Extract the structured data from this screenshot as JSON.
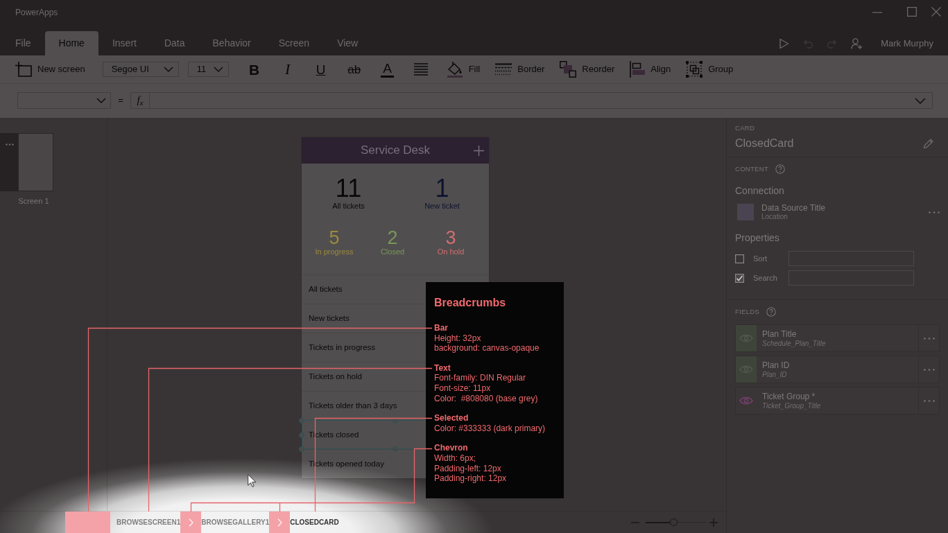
{
  "window": {
    "title": "PowerApps"
  },
  "ribbon_tabs": [
    {
      "label": "File",
      "selected": false
    },
    {
      "label": "Home",
      "selected": true
    },
    {
      "label": "Insert",
      "selected": false
    },
    {
      "label": "Data",
      "selected": false
    },
    {
      "label": "Behavior",
      "selected": false
    },
    {
      "label": "Screen",
      "selected": false
    },
    {
      "label": "View",
      "selected": false
    }
  ],
  "quick_actions": [
    {
      "kind": "play",
      "disabled": false
    },
    {
      "kind": "undo",
      "disabled": true
    },
    {
      "kind": "redo",
      "disabled": true
    },
    {
      "kind": "add_user",
      "disabled": false
    }
  ],
  "user": {
    "name": "Mark Murphy"
  },
  "toolbar": {
    "new_screen": "New screen",
    "font": "Segoe UI",
    "font_size": "11",
    "format_buttons": [
      {
        "kind": "bold",
        "glyph": "B"
      },
      {
        "kind": "italic",
        "glyph": "I"
      },
      {
        "kind": "underline",
        "glyph": "U"
      },
      {
        "kind": "strikethrough",
        "glyph": "ab"
      },
      {
        "kind": "font_color",
        "glyph": "A"
      }
    ],
    "tools": [
      {
        "kind": "fill",
        "label": "Fill"
      },
      {
        "kind": "border",
        "label": "Border"
      },
      {
        "kind": "reorder",
        "label": "Reorder"
      },
      {
        "kind": "align",
        "label": "Align"
      },
      {
        "kind": "group",
        "label": "Group"
      }
    ]
  },
  "formula_bar": {
    "equals": "=",
    "function": "f$_{x}$"
  },
  "screens": [
    {
      "label": "Screen 1",
      "selected": true
    }
  ],
  "app_preview": {
    "title": "Service Desk",
    "totals": [
      {
        "value": "11",
        "label": "All tickets",
        "color": "#0a0808"
      },
      {
        "value": "1",
        "label": "New ticket",
        "color": "#0d1230"
      }
    ],
    "statuses": [
      {
        "value": "5",
        "label": "In progress",
        "color": "#9a8b3e"
      },
      {
        "value": "2",
        "label": "Closed",
        "color": "#779858"
      },
      {
        "value": "3",
        "label": "On hold",
        "color": "#d46e70"
      }
    ],
    "menu": [
      {
        "label": "All tickets",
        "selected": false
      },
      {
        "label": "New tickets",
        "selected": false
      },
      {
        "label": "Tickets in progress",
        "selected": false
      },
      {
        "label": "Tickets on hold",
        "selected": false
      },
      {
        "label": "Tickets older than 3 days",
        "selected": false
      },
      {
        "label": "Tickets closed",
        "selected": true
      },
      {
        "label": "Tickets opened today",
        "selected": false
      }
    ]
  },
  "breadcrumbs": [
    {
      "label": "BROWSESCREEN1",
      "selected": false
    },
    {
      "label": "BROWSEGALLERY1",
      "selected": false
    },
    {
      "label": "CLOSEDCARD",
      "selected": true
    }
  ],
  "zoom": {
    "level": 0.46
  },
  "properties_panel": {
    "type_label": "CARD",
    "name": "ClosedCard",
    "content": {
      "heading": "CONTENT",
      "connection_label": "Connection",
      "data_source": {
        "title": "Data Source Title",
        "subtitle": "Location"
      },
      "properties_label": "Properties",
      "options": [
        {
          "label": "Sort",
          "checked": false
        },
        {
          "label": "Search",
          "checked": true
        }
      ]
    },
    "fields_heading": "FIELDS",
    "fields": [
      {
        "title": "Plan Title",
        "column": "Schedule_Plan_Title",
        "selected": true
      },
      {
        "title": "Plan ID",
        "column": "Plan_ID",
        "selected": true
      },
      {
        "title": "Ticket Group *",
        "column": "Ticket_Group_Title",
        "selected": false
      }
    ]
  },
  "annotation": {
    "title": "Breadcrumbs",
    "sections": [
      {
        "kind": "bar",
        "heading": "Bar",
        "lines": [
          "Height: 32px",
          "background: canvas-opaque"
        ]
      },
      {
        "kind": "text",
        "heading": "Text",
        "lines": [
          "Font-family: DIN Regular",
          "Font-size: 11px",
          "Color:  #808080 (base grey)"
        ]
      },
      {
        "kind": "selected",
        "heading": "Selected",
        "lines": [
          "Color: #333333 (dark primary)"
        ]
      },
      {
        "kind": "chevron",
        "heading": "Chevron",
        "lines": [
          "Width: 6px;",
          "Padding-left: 12px",
          "Padding-right: 12px"
        ]
      }
    ]
  }
}
